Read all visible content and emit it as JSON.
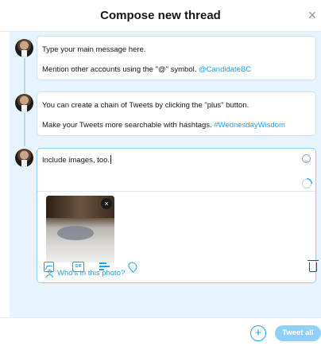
{
  "header": {
    "title": "Compose new thread",
    "close_label": "×"
  },
  "tweets": [
    {
      "line1": "Type your main message here.",
      "line2_text": "Mention other accounts using the \"@\" symbol. ",
      "line2_link": "@CandidateBC"
    },
    {
      "line1": "You can create a chain of Tweets by clicking the \"plus\" button.",
      "line2_text": "Make your Tweets more searchable with hashtags. ",
      "line2_link": "#WednesdayWisdom"
    },
    {
      "text": "Include images, too."
    }
  ],
  "media": {
    "remove_label": "×",
    "tag_label": "Who's in this photo?"
  },
  "toolbar": {
    "icons": [
      "image-icon",
      "gif-icon",
      "poll-icon",
      "location-icon",
      "trash-icon"
    ],
    "gif_label": "GIF"
  },
  "footer": {
    "add_label": "+",
    "tweet_all_label": "Tweet all"
  },
  "colors": {
    "accent": "#1da1f2",
    "thread_background": "#e8f4fd",
    "button_disabled": "#8ed0f9"
  }
}
